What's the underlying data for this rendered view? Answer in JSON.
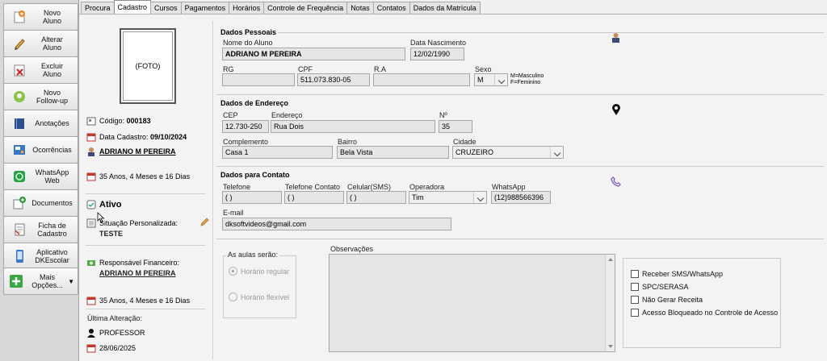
{
  "sidebar": [
    {
      "name": "novo-aluno-button",
      "icon": "new-student-icon",
      "label": "Novo\nAluno"
    },
    {
      "name": "alterar-aluno-button",
      "icon": "edit-student-icon",
      "label": "Alterar\nAluno"
    },
    {
      "name": "excluir-aluno-button",
      "icon": "delete-student-icon",
      "label": "Excluir\nAluno"
    },
    {
      "name": "novo-follow-up-button",
      "icon": "follow-up-icon",
      "label": "Novo\nFollow-up"
    },
    {
      "name": "anotacoes-button",
      "icon": "book-icon",
      "label": "Anotações"
    },
    {
      "name": "ocorrencias-button",
      "icon": "occurrence-icon",
      "label": "Ocorrências"
    },
    {
      "name": "whatsapp-web-button",
      "icon": "whatsapp-icon",
      "label": "WhatsApp\nWeb"
    },
    {
      "name": "documentos-button",
      "icon": "documents-icon",
      "label": "Documentos"
    },
    {
      "name": "ficha-cadastro-button",
      "icon": "form-icon",
      "label": "Ficha de\nCadastro"
    },
    {
      "name": "aplicativo-dkescolar-button",
      "icon": "phone-icon",
      "label": "Aplicativo\nDKEscolar"
    },
    {
      "name": "mais-opcoes-button",
      "icon": "plus-icon",
      "label": "Mais\nOpções..."
    }
  ],
  "tabs": [
    "Procura",
    "Cadastro",
    "Cursos",
    "Pagamentos",
    "Horários",
    "Controle de Frequência",
    "Notas",
    "Contatos",
    "Dados da Matrícula"
  ],
  "active_tab": "Cadastro",
  "left_panel": {
    "photo": "(FOTO)",
    "codigo_label": "Código:",
    "codigo": "000183",
    "data_cadastro_label": "Data Cadastro:",
    "data_cadastro": "09/10/2024",
    "student_name": "ADRIANO M PEREIRA",
    "student_age": "35 Anos, 4 Meses  e 16 Dias",
    "status": "Ativo",
    "situacao_label": "Situação Personalizada:",
    "situacao": "TESTE",
    "responsavel_label": "Responsável Financeiro:",
    "responsavel": "ADRIANO M PEREIRA",
    "responsavel_age": "35 Anos, 4 Meses  e 16 Dias",
    "ultima_alteracao_label": "Última Alteração:",
    "ultima_alteracao_user": "PROFESSOR",
    "ultima_alteracao_date": "28/06/2025"
  },
  "dados_pessoais": {
    "title": "Dados Pessoais",
    "nome_label": "Nome do Aluno",
    "nome": "ADRIANO M PEREIRA",
    "nascimento_label": "Data Nascimento",
    "nascimento": "12/02/1990",
    "rg_label": "RG",
    "rg": "",
    "cpf_label": "CPF",
    "cpf": "511.073.830-05",
    "ra_label": "R.A",
    "ra": "",
    "sexo_label": "Sexo",
    "sexo": "M",
    "sexo_hint_1": "M=Masculino",
    "sexo_hint_2": "F=Feminino"
  },
  "dados_endereco": {
    "title": "Dados de Endereço",
    "cep_label": "CEP",
    "cep": "12.730-250",
    "endereco_label": "Endereço",
    "endereco": "Rua Dois",
    "numero_label": "Nº",
    "numero": "35",
    "complemento_label": "Complemento",
    "complemento": "Casa 1",
    "bairro_label": "Bairro",
    "bairro": "Bela Vista",
    "cidade_label": "Cidade",
    "cidade": "CRUZEIRO"
  },
  "dados_contato": {
    "title": "Dados para Contato",
    "telefone_label": "Telefone",
    "telefone": "(   )",
    "telefone_contato_label": "Telefone Contato",
    "telefone_contato": "(   )",
    "celular_label": "Celular(SMS)",
    "celular": "(   )",
    "operadora_label": "Operadora",
    "operadora": "Tim",
    "whatsapp_label": "WhatsApp",
    "whatsapp": "(12)988566396",
    "email_label": "E-mail",
    "email": "dksoftvideos@gmail.com"
  },
  "aulas": {
    "title": "As aulas serão:",
    "regular": "Horário regular",
    "flexivel": "Horário flexível",
    "selected": "regular"
  },
  "observacoes": {
    "label": "Observações",
    "value": ""
  },
  "checkboxes": [
    {
      "label": "Receber SMS/WhatsApp",
      "checked": false
    },
    {
      "label": "SPC/SERASA",
      "checked": false
    },
    {
      "label": "Não Gerar Receita",
      "checked": false
    },
    {
      "label": "Acesso Bloqueado no Controle de Acesso",
      "checked": false
    }
  ],
  "colors": {
    "accent_red": "#c0392b",
    "whatsapp_green": "#25a244",
    "link_purple": "#7a4fbf"
  }
}
